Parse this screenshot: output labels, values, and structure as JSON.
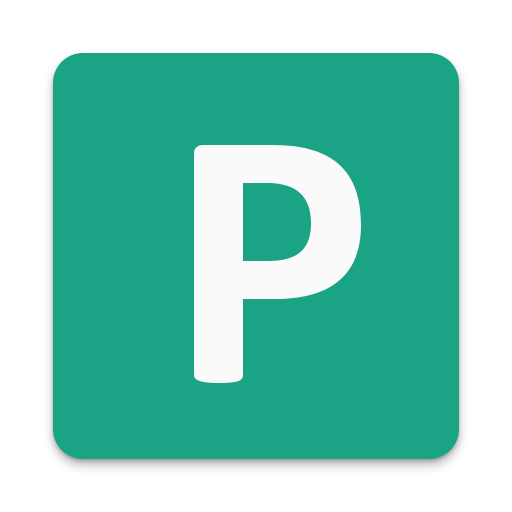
{
  "app_icon": {
    "name": "parking-app-icon",
    "letter": "P",
    "colors": {
      "tile": "#1aa385",
      "glyph": "#fafafa"
    }
  }
}
